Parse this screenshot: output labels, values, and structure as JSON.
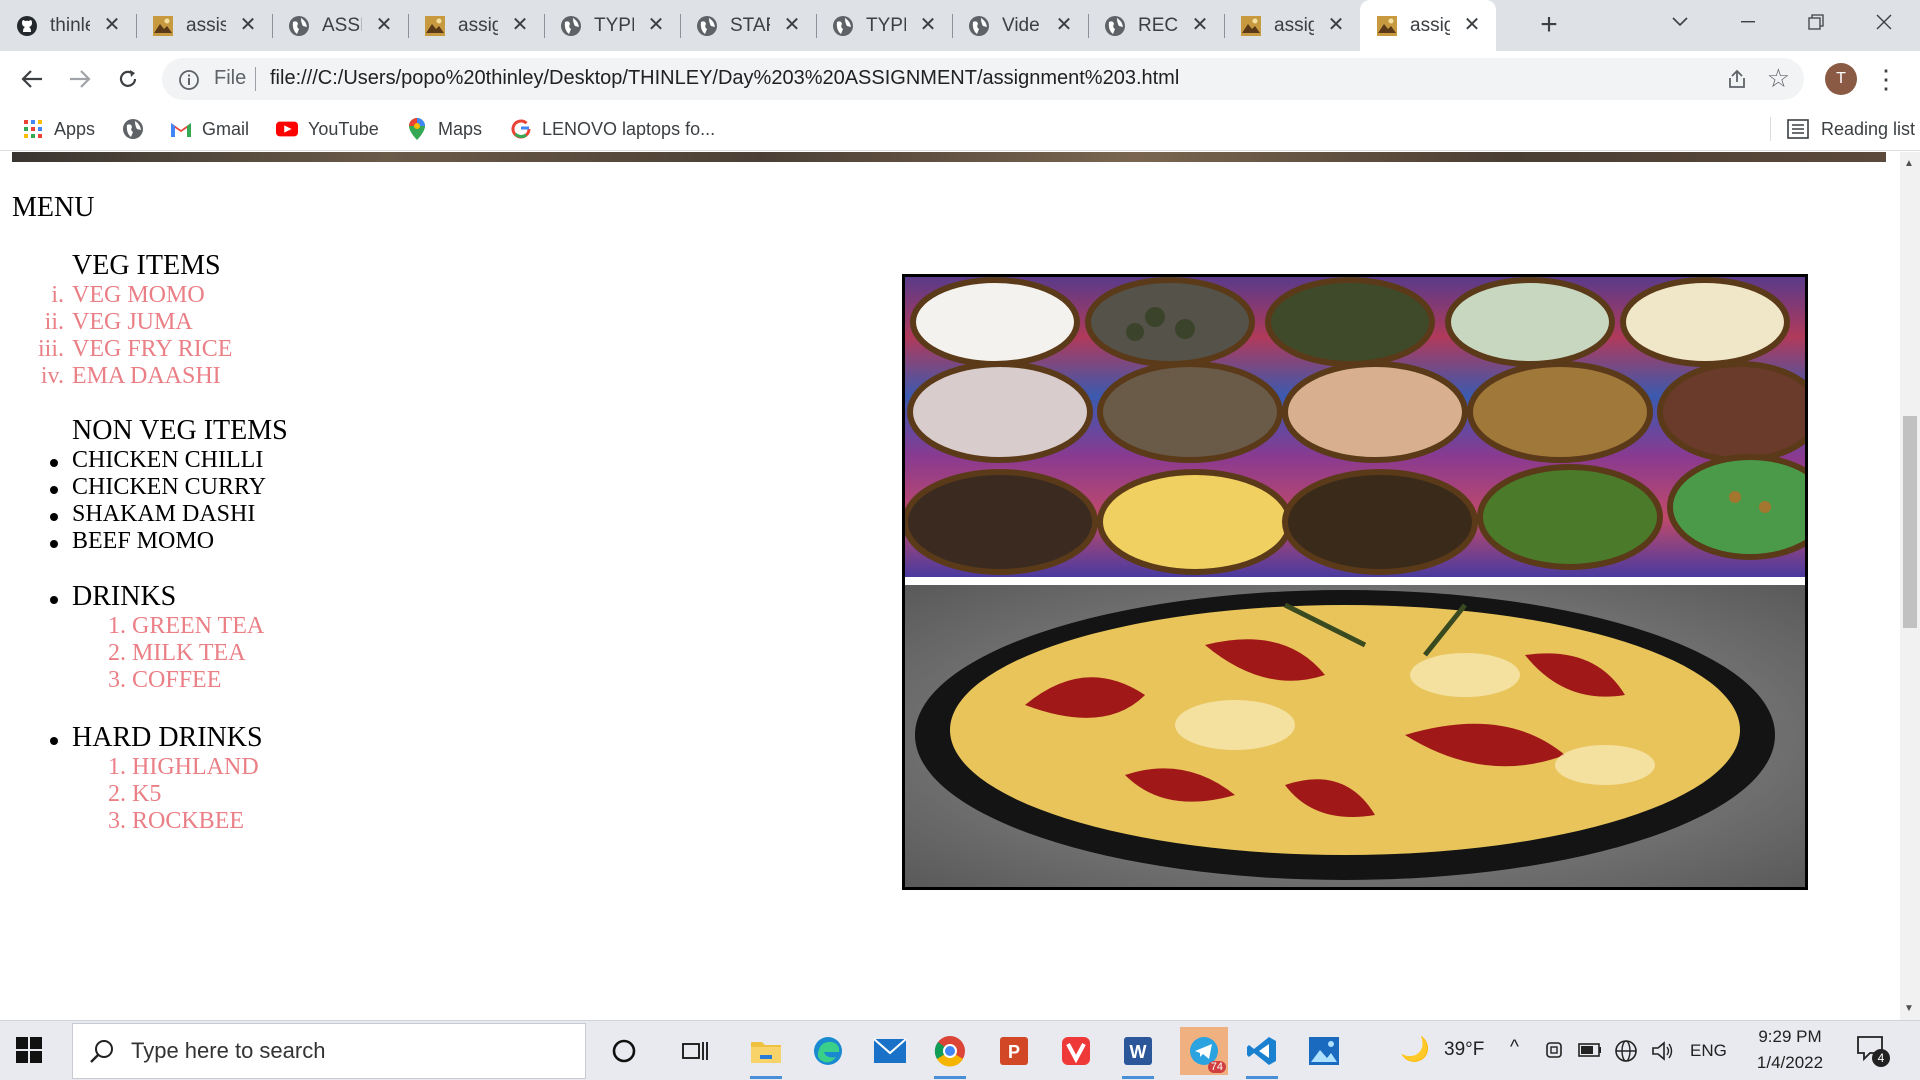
{
  "browser": {
    "tabs": [
      {
        "title": "thinle",
        "icon": "github-icon"
      },
      {
        "title": "assis",
        "icon": "image-icon"
      },
      {
        "title": "ASSI",
        "icon": "globe-icon"
      },
      {
        "title": "assig",
        "icon": "image-icon"
      },
      {
        "title": "TYPE",
        "icon": "globe-icon"
      },
      {
        "title": "STAF",
        "icon": "globe-icon"
      },
      {
        "title": "TYPE",
        "icon": "globe-icon"
      },
      {
        "title": "Vide",
        "icon": "globe-icon"
      },
      {
        "title": "RECII",
        "icon": "globe-icon"
      },
      {
        "title": "assig",
        "icon": "image-icon"
      },
      {
        "title": "assig",
        "icon": "image-icon",
        "active": true
      }
    ],
    "address_bar": {
      "scheme_label": "File",
      "url": "file:///C:/Users/popo%20thinley/Desktop/THINLEY/Day%203%20ASSIGNMENT/assignment%203.html"
    },
    "profile_initial": "T",
    "bookmarks": [
      {
        "label": "Apps",
        "icon": "apps-grid-icon"
      },
      {
        "label": "",
        "icon": "globe-icon"
      },
      {
        "label": "Gmail",
        "icon": "gmail-icon"
      },
      {
        "label": "YouTube",
        "icon": "youtube-icon"
      },
      {
        "label": "Maps",
        "icon": "maps-pin-icon"
      },
      {
        "label": "LENOVO laptops fo...",
        "icon": "google-icon"
      }
    ],
    "reading_list": "Reading list"
  },
  "page": {
    "heading": "MENU",
    "veg": {
      "title": "VEG ITEMS",
      "markers": [
        "i.",
        "ii.",
        "iii.",
        "iv."
      ],
      "items": [
        "VEG MOMO",
        "VEG JUMA",
        "VEG FRY RICE",
        "EMA DAASHI"
      ]
    },
    "nonveg": {
      "title": "NON VEG ITEMS",
      "items": [
        "CHICKEN CHILLI",
        "CHICKEN CURRY",
        "SHAKAM DASHI",
        "BEEF MOMO"
      ]
    },
    "drinks": {
      "title": "DRINKS",
      "markers": [
        "1.",
        "2.",
        "3."
      ],
      "items": [
        "GREEN TEA",
        "MILK TEA",
        "COFFEE"
      ]
    },
    "hard_drinks": {
      "title": "HARD DRINKS",
      "markers": [
        "1.",
        "2.",
        "3."
      ],
      "items": [
        "HIGHLAND",
        "K5",
        "ROCKBEE"
      ]
    },
    "colors": {
      "sub_item": "#ea7f86",
      "text": "#000000"
    }
  },
  "taskbar": {
    "search_placeholder": "Type here to search",
    "weather": "39°F",
    "language": "ENG",
    "time": "9:29 PM",
    "date": "1/4/2022",
    "notification_count": "4",
    "telegram_badge": "74"
  }
}
